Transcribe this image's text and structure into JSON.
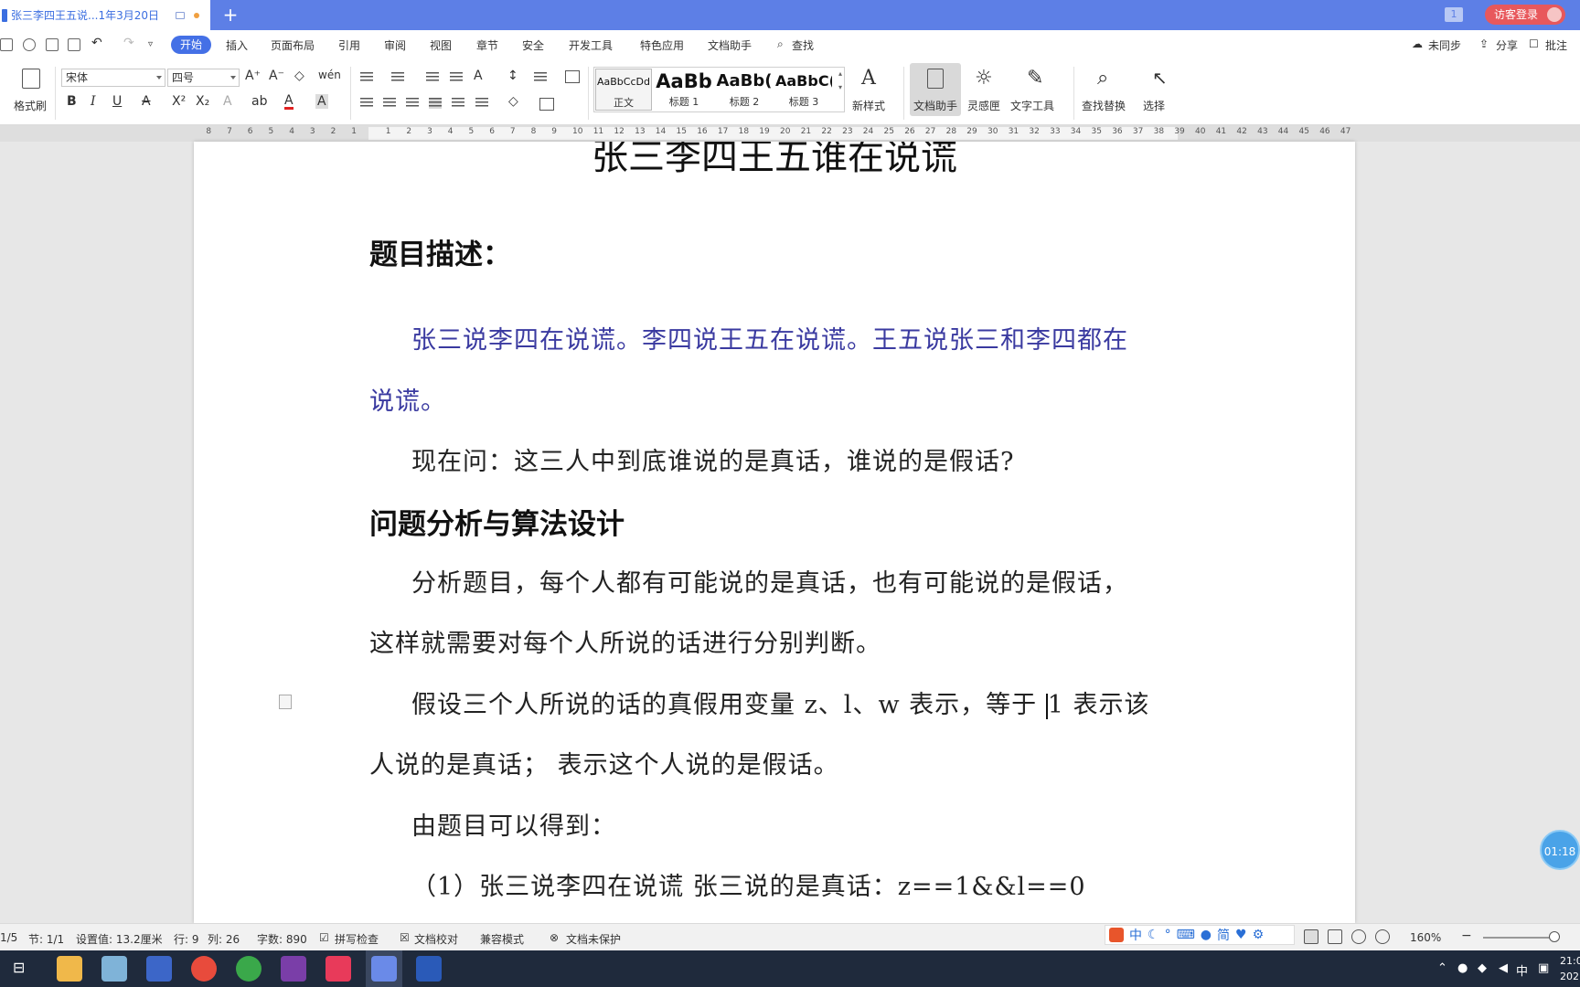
{
  "titlebar": {
    "tab_title": "张三李四王五说...1年3月20日",
    "new_tab": "+",
    "tab_count": "1",
    "guest_login": "访客登录"
  },
  "menu": {
    "items": [
      "开始",
      "插入",
      "页面布局",
      "引用",
      "审阅",
      "视图",
      "章节",
      "安全",
      "开发工具",
      "特色应用",
      "文档助手",
      "查找"
    ],
    "right": [
      "未同步",
      "分享",
      "批注"
    ]
  },
  "ribbon": {
    "format_painter": "格式刷",
    "font_name": "宋体",
    "font_size": "四号",
    "styles": [
      {
        "sample": "AaBbCcDd",
        "name": "正文"
      },
      {
        "sample": "AaBb",
        "name": "标题 1"
      },
      {
        "sample": "AaBb(",
        "name": "标题 2"
      },
      {
        "sample": "AaBbC(",
        "name": "标题 3"
      }
    ],
    "new_style": "新样式",
    "doc_assistant": "文档助手",
    "inspiration": "灵感匣",
    "text_tools": "文字工具",
    "find_replace": "查找替换",
    "select": "选择",
    "bold": "B",
    "italic": "I",
    "underline": "U"
  },
  "ruler": {
    "left_ticks": [
      "8",
      "7",
      "6",
      "5",
      "4",
      "3",
      "2",
      "1"
    ],
    "right_ticks": [
      "1",
      "2",
      "3",
      "4",
      "5",
      "6",
      "7",
      "8",
      "9",
      "10",
      "11",
      "12",
      "13",
      "14",
      "15",
      "16",
      "17",
      "18",
      "19",
      "20",
      "21",
      "22",
      "23",
      "24",
      "25",
      "26",
      "27",
      "28",
      "29",
      "30",
      "31",
      "32",
      "33",
      "34",
      "35",
      "36",
      "37",
      "38",
      "39",
      "40",
      "41",
      "42",
      "43",
      "44",
      "45",
      "46",
      "47"
    ]
  },
  "document": {
    "title": "张三李四王五谁在说谎",
    "heading1": "题目描述：",
    "p1_line1": "张三说李四在说谎。李四说王五在说谎。王五说张三和李四都在",
    "p1_line2": "说谎。",
    "p2": "现在问：这三人中到底谁说的是真话，谁说的是假话?",
    "heading2": "问题分析与算法设计",
    "p3_line1": "分析题目，每个人都有可能说的是真话，也有可能说的是假话，",
    "p3_line2": "这样就需要对每个人所说的话进行分别判断。",
    "p4_line1_a": "假设三个人所说的话的真假用变量 z、l、w 表示，等于 ",
    "p4_line1_b": "1 表示该",
    "p4_line2": "人说的是真话；  表示这个人说的是假话。",
    "p5": "由题目可以得到：",
    "p6": "（1）张三说李四在说谎  张三说的是真话：z==1&&l==0"
  },
  "status": {
    "page": "1/5",
    "section": "节: 1/1",
    "setting": "设置值: 13.2厘米",
    "row": "行: 9",
    "col": "列: 26",
    "words": "字数: 890",
    "spell": "拼写检查",
    "proof": "文档校对",
    "compat": "兼容模式",
    "protect": "文档未保护",
    "zoom": "160%",
    "ime": [
      "中",
      "简"
    ]
  },
  "timer": "01:18",
  "taskbar": {
    "tray_lang": "中",
    "clock_time": "21:0",
    "clock_date": "202"
  },
  "colors": {
    "titlebar": "#5d7fe6",
    "accent": "#4470e6",
    "blue_text": "#3a3aa0"
  }
}
